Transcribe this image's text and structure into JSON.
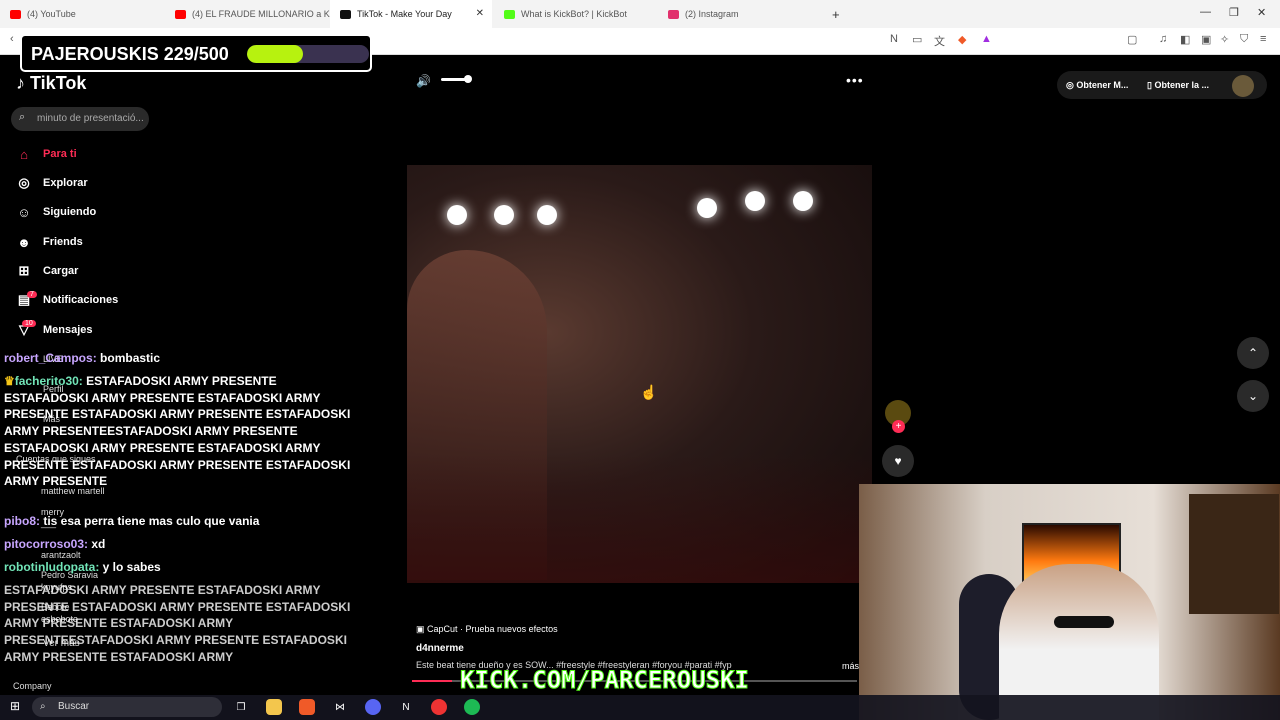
{
  "browser": {
    "tabs": [
      {
        "label": "(4) YouTube",
        "color": "#ff0000"
      },
      {
        "label": "(4) EL FRAUDE MILLONARIO a KICK p...",
        "color": "#ff0000"
      },
      {
        "label": "TikTok - Make Your Day",
        "color": "#111111"
      },
      {
        "label": "What is KickBot? | KickBot",
        "color": "#53fc18"
      },
      {
        "label": "(2) Instagram",
        "color": "#e1306c"
      }
    ],
    "new_tab": "+",
    "close_tab": "✕"
  },
  "goal": {
    "label": "PAJEROUSKIS 229/500",
    "progress": 0.458
  },
  "tiktok": {
    "logo": "TikTok",
    "search_placeholder": "minuto de presentació...",
    "nav": [
      {
        "label": "Para ti",
        "icon": "home-icon"
      },
      {
        "label": "Explorar",
        "icon": "compass-icon"
      },
      {
        "label": "Siguiendo",
        "icon": "following-icon"
      },
      {
        "label": "Friends",
        "icon": "friends-icon"
      },
      {
        "label": "Cargar",
        "icon": "upload-icon"
      },
      {
        "label": "Notificaciones",
        "icon": "bell-icon",
        "badge": "7"
      },
      {
        "label": "Mensajes",
        "icon": "send-icon",
        "badge": "10"
      }
    ],
    "hidden_items": {
      "live": "LIVE",
      "profile": "Perfil",
      "more": "Más",
      "following_accounts": "Cuentas que sigues",
      "accounts": [
        {
          "name": "matthew martell"
        },
        {
          "name": "merry",
          "handle": "___"
        },
        {
          "name": "arantzaolt"
        },
        {
          "name": "Pedro Saravia",
          "handle": "knyufps"
        },
        {
          "name": "Bebote",
          "handle": "esbebote"
        }
      ],
      "see_more": "Ver más",
      "company": "Company"
    },
    "top_right": {
      "btn1": "Obtener M...",
      "btn2": "Obtener la ..."
    },
    "video": {
      "capcut": "CapCut · Prueba nuevos efectos",
      "author": "d4nnerme",
      "description": "Este beat tiene dueño y es SOW... #freestyle #freestyleran #foryou #parati #fyp",
      "more": "más"
    }
  },
  "chat": [
    {
      "user": "robert_Campos",
      "text": "bombastic"
    },
    {
      "user": "facherito30",
      "text": "ESTAFADOSKI ARMY PRESENTE ESTAFADOSKI ARMY PRESENTE ESTAFADOSKI ARMY PRESENTE ESTAFADOSKI ARMY PRESENTE ESTAFADOSKI ARMY PRESENTEESTAFADOSKI ARMY PRESENTE ESTAFADOSKI ARMY PRESENTE ESTAFADOSKI ARMY PRESENTE ESTAFADOSKI ARMY PRESENTE ESTAFADOSKI ARMY PRESENTE"
    },
    {
      "user": "pibo8",
      "text": "tis esa perra tiene mas culo que vania"
    },
    {
      "user": "pitocorroso03",
      "text": "xd"
    },
    {
      "user": "robotinludopata",
      "text": "y lo sabes"
    },
    {
      "user": "",
      "text": "ESTAFADOSKI ARMY PRESENTE ESTAFADOSKI ARMY PRESENTE ESTAFADOSKI ARMY PRESENTE ESTAFADOSKI ARMY PRESENTE ESTAFADOSKI ARMY PRESENTEESTAFADOSKI ARMY PRESENTE ESTAFADOSKI ARMY PRESENTE ESTAFADOSKI ARMY"
    }
  ],
  "overlay": {
    "kick": "KICK.COM/PARCEROUSKI"
  },
  "taskbar": {
    "search": "Buscar"
  }
}
